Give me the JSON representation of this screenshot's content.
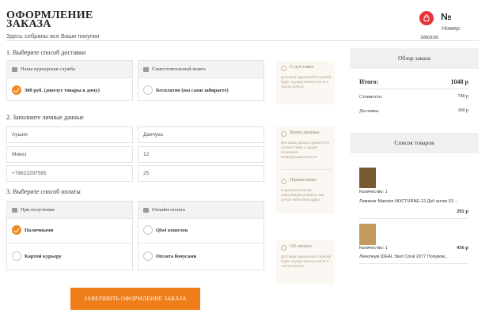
{
  "header": {
    "title_line1": "ОФОРМЛЕНИЕ",
    "title_line2": "ЗАКАЗА",
    "subtitle": "Здесь собраны все Ваши покупки",
    "order_number_symbol": "№",
    "order_label": "Номер",
    "order_label2": "заказа",
    "cart_icon": "shopping-bag-icon",
    "accent": "#e5343b"
  },
  "delivery": {
    "section_title": "1. Выберите способ доставки",
    "courier_head": "Наша курьерская служба",
    "courier_option": "300 руб. (довезут товары к дому)",
    "courier_selected": true,
    "pickup_head": "Самостоятельный вывоз",
    "pickup_option": "Бесплатно (вы сами забираете)",
    "pickup_selected": false,
    "info_title": "О доставке",
    "info_text": "Доставка курьерской службой будет осуществлена после 3 часов оплаты"
  },
  "personal": {
    "section_title": "2. Заполните личные данные",
    "fields": {
      "first_name": "Аушня",
      "last_name": "Даичука",
      "patronymic": "Микиз",
      "number": "12",
      "phone": "+79622297585",
      "extra": "25"
    },
    "info_title": "Ваши данные",
    "info_text": "Все ваши данные хранятся в соответствии с нашей политикой конфиденциальности",
    "note_title": "Примечание",
    "note_text": "В дополнительной информации укажите, как лучше найти ваш адрес"
  },
  "payment": {
    "section_title": "3. Выберите способ оплаты",
    "on_receipt_head": "При получении",
    "online_head": "Онлайн-оплата",
    "options": {
      "cash": "Наличными",
      "courier_card": "Картой курьеру",
      "qiwi": "Qiwi кошелек",
      "bonus": "Оплата бонусами"
    },
    "selected": "cash",
    "info_title": "Об оплате",
    "info_text": "Доставка курьерской службой будет осуществлена после 3 часов оплаты"
  },
  "summary": {
    "title": "Обзор заказа",
    "total_label": "Итого:",
    "total_value": "1048 р",
    "cost_label": "Стоимость:",
    "cost_value": "748 р",
    "delivery_label": "Доставка:",
    "delivery_value": "300 р"
  },
  "products": {
    "title": "Список товаров",
    "items": [
      {
        "qty": "Количество: 1",
        "name": "Ламинат Maestro NOCTURNE-12 Дуб антик 33 ...",
        "price": "292 р"
      },
      {
        "qty": "Количество: 1",
        "name": "Линолеум IDEAL Start Coral 2077 Полувом...",
        "price": "456 р"
      }
    ]
  },
  "submit_label": "ЗАВЕРШИТЬ ОФОРМЛЕНИЕ ЗАКАЗА",
  "colors": {
    "primary": "#ef7d1a",
    "check": "#f08a1d",
    "info_bg": "#fbf7f2"
  }
}
